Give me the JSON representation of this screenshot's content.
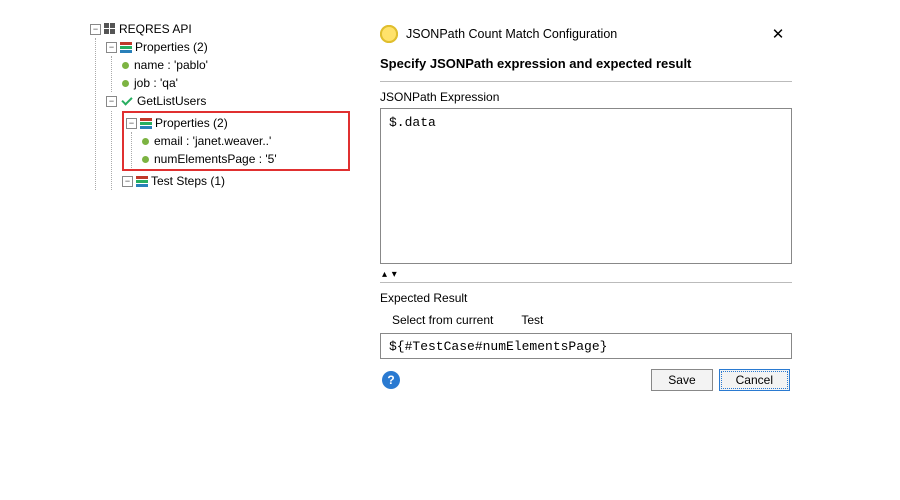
{
  "tree": {
    "root": "REQRES API",
    "propsRoot": "Properties (2)",
    "prop1": "name : 'pablo'",
    "prop2": "job : 'qa'",
    "getList": "GetListUsers",
    "propsInner": "Properties (2)",
    "propEmail": "email : 'janet.weaver..'",
    "propNum": "numElementsPage : '5'",
    "testSteps": "Test Steps (1)"
  },
  "dialog": {
    "title": "JSONPath Count Match Configuration",
    "heading": "Specify JSONPath expression and expected result",
    "jsonpathLabel": "JSONPath Expression",
    "jsonpathValue": "$.data",
    "expectedLabel": "Expected Result",
    "linkSelect": "Select from current",
    "linkTest": "Test",
    "expectedValue": "${#TestCase#numElementsPage}",
    "save": "Save",
    "cancel": "Cancel"
  }
}
